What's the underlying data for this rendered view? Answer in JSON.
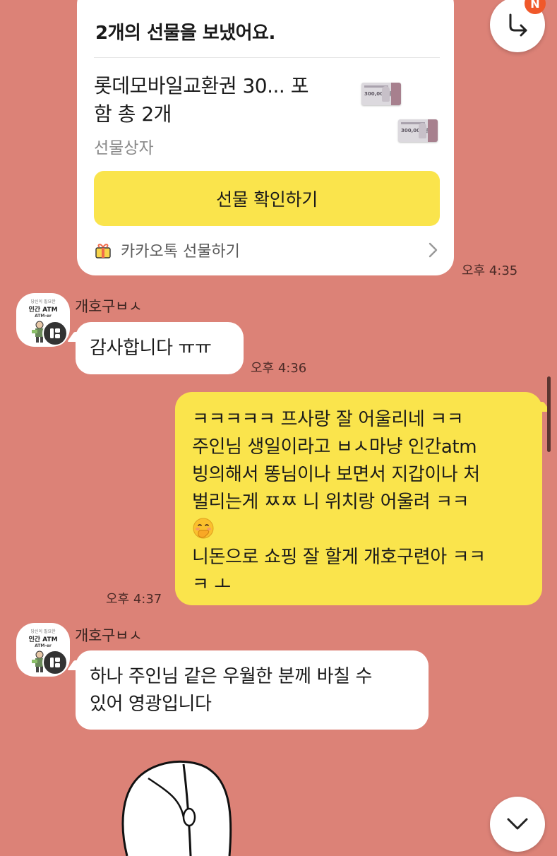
{
  "gift_message": {
    "title": "2개의 선물을 보냈어요.",
    "product_line1": "롯데모바일교환권 30... 포",
    "product_line2": "함 총 2개",
    "subtitle": "선물상자",
    "voucher_label": "300,000원",
    "confirm_button": "선물 확인하기",
    "footer_label": "카카오톡 선물하기",
    "time": "오후 4:35"
  },
  "messages": [
    {
      "sender": "개호구ㅂㅅ",
      "avatar_lines": [
        "당신이 필요한",
        "인간 ATM",
        "ATM-er"
      ],
      "text": "감사합니다 ㅠㅠ",
      "time": "오후 4:36"
    },
    {
      "outgoing": true,
      "lines": [
        "ㅋㅋㅋㅋㅋ 프사랑 잘 어울리네 ㅋㅋ",
        "주인님 생일이라고 ㅂㅅ마냥 인간atm",
        "빙의해서 똥님이나 보면서 지갑이나 처",
        "벌리는게 ㅉㅉ 니 위치랑 어울려 ㅋㅋ",
        "니돈으로 쇼핑 잘 할게 개호구련아 ㅋㅋ",
        "ㅋ ㅗ"
      ],
      "emoji": "face-with-hand-over-mouth",
      "time": "오후 4:37"
    },
    {
      "sender": "개호구ㅂㅅ",
      "avatar_lines": [
        "당신이 필요한",
        "인간 ATM",
        "ATM-er"
      ],
      "lines": [
        "하나 주인님 같은 우월한 분께 바칠 수",
        "있어 영광입니다"
      ]
    }
  ],
  "controls": {
    "share_badge": "N",
    "share_icon": "share-arrow-icon",
    "scroll_down_icon": "chevron-down-icon"
  },
  "colors": {
    "chat_background": "#dc8277",
    "outgoing_bubble": "#fae44c",
    "gift_button": "#fae44c",
    "incoming_bubble": "#ffffff"
  }
}
